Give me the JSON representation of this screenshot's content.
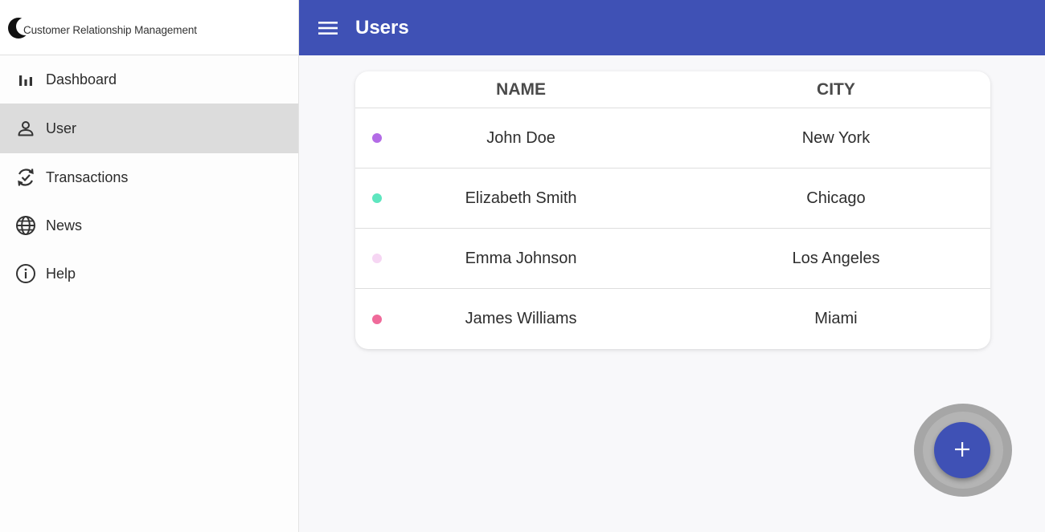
{
  "brand": {
    "name": "Customer Relationship Management"
  },
  "sidebar": {
    "items": [
      {
        "label": "Dashboard",
        "icon": "bar-chart-icon",
        "active": false
      },
      {
        "label": "User",
        "icon": "person-icon",
        "active": true
      },
      {
        "label": "Transactions",
        "icon": "sync-check-icon",
        "active": false
      },
      {
        "label": "News",
        "icon": "globe-icon",
        "active": false
      },
      {
        "label": "Help",
        "icon": "info-icon",
        "active": false
      }
    ]
  },
  "header": {
    "title": "Users",
    "menu_icon": "hamburger-menu-icon"
  },
  "table": {
    "columns": [
      "NAME",
      "CITY"
    ],
    "rows": [
      {
        "name": "John Doe",
        "city": "New York",
        "color": "#b36be6"
      },
      {
        "name": "Elizabeth Smith",
        "city": "Chicago",
        "color": "#5ee6bf"
      },
      {
        "name": "Emma Johnson",
        "city": "Los Angeles",
        "color": "#f6d6f3"
      },
      {
        "name": "James Williams",
        "city": "Miami",
        "color": "#ef6a9a"
      }
    ]
  },
  "fab": {
    "icon": "plus-icon"
  },
  "colors": {
    "primary": "#3f51b5",
    "active_nav": "#dcdcdc"
  }
}
